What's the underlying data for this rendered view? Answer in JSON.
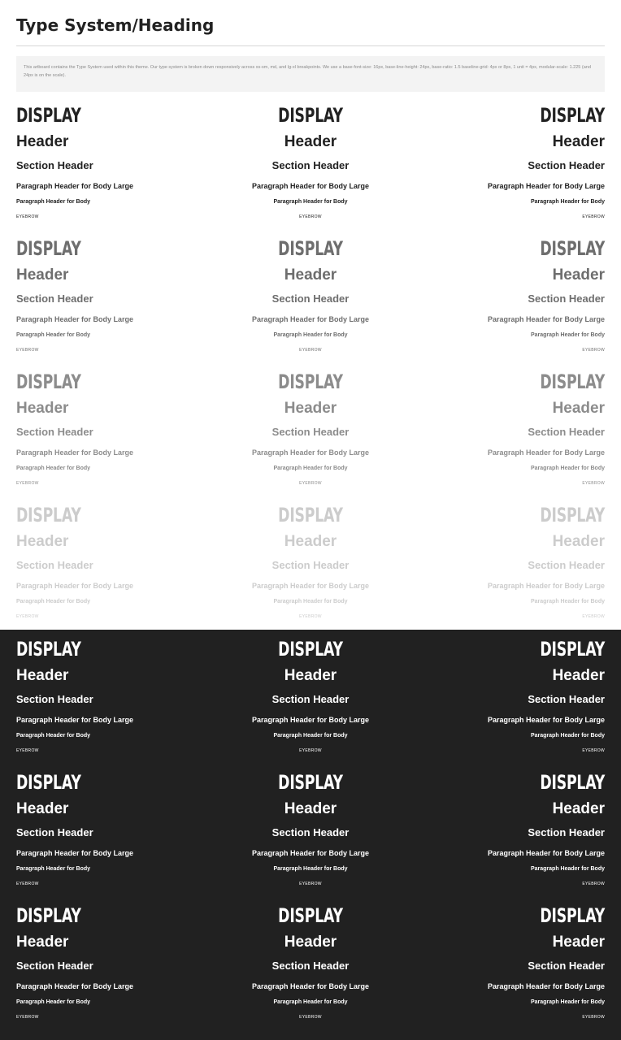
{
  "page": {
    "title": "Type System/Heading",
    "description": "This artboard contains the Type System used within this theme. Our type system is broken down responsively across xs-sm, md, and lg-xl breakpoints. We use a base-font-size: 16px, base-line-height: 24px, base-ratio: 1.5 baseline-grid: 4px or 8px, 1 unit = 4px, modular-scale: 1.225 (and 24px is on the scale)."
  },
  "specimen_text": {
    "display": "DISPLAY",
    "header": "Header",
    "section_header": "Section Header",
    "paragraph_header_large": "Paragraph Header for Body Large",
    "paragraph_header": "Paragraph Header for Body",
    "eyebrow": "EYEBROW"
  },
  "alignments": [
    "left",
    "center",
    "right"
  ],
  "colors": {
    "light_background": "#ffffff",
    "dark_background": "#212121",
    "description_background": "#f3f3f3",
    "rows": [
      {
        "theme": "light",
        "text_color": "#222222"
      },
      {
        "theme": "light",
        "text_color": "#6e6e6e"
      },
      {
        "theme": "light",
        "text_color": "#8c8c8c"
      },
      {
        "theme": "light",
        "text_color": "#cccccc"
      },
      {
        "theme": "dark",
        "text_color": "#ffffff"
      },
      {
        "theme": "dark",
        "text_color": "#ffffff"
      },
      {
        "theme": "dark",
        "text_color": "#ffffff"
      }
    ]
  }
}
